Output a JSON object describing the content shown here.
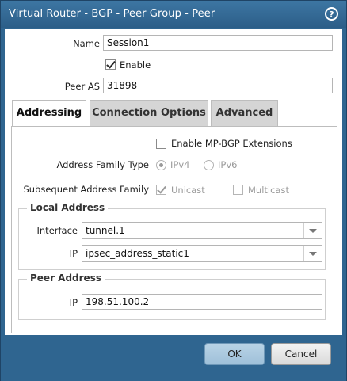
{
  "window": {
    "title": "Virtual Router - BGP - Peer Group - Peer",
    "help_icon": "help-icon"
  },
  "form": {
    "name_label": "Name",
    "name_value": "Session1",
    "enable_label": "Enable",
    "enable_checked": true,
    "peer_as_label": "Peer AS",
    "peer_as_value": "31898"
  },
  "tabs": [
    {
      "label": "Addressing",
      "active": true
    },
    {
      "label": "Connection Options",
      "active": false
    },
    {
      "label": "Advanced",
      "active": false
    }
  ],
  "addressing": {
    "mp_bgp_label": "Enable MP-BGP Extensions",
    "mp_bgp_checked": false,
    "address_family_label": "Address Family Type",
    "ipv4_label": "IPv4",
    "ipv6_label": "IPv6",
    "subsequent_label": "Subsequent Address Family",
    "unicast_label": "Unicast",
    "multicast_label": "Multicast"
  },
  "local_address": {
    "legend": "Local Address",
    "interface_label": "Interface",
    "interface_value": "tunnel.1",
    "ip_label": "IP",
    "ip_value": "ipsec_address_static1"
  },
  "peer_address": {
    "legend": "Peer Address",
    "ip_label": "IP",
    "ip_value": "198.51.100.2"
  },
  "buttons": {
    "ok_label": "OK",
    "cancel_label": "Cancel"
  },
  "colors": {
    "title_bar": "#2f6590",
    "ok_button": "#a9c8de"
  }
}
